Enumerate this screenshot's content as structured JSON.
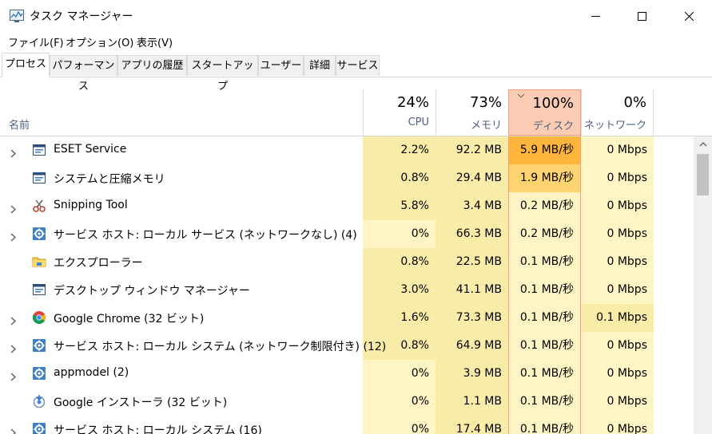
{
  "window": {
    "title": "タスク マネージャー",
    "icon": "task-manager-icon"
  },
  "menu": {
    "file": "ファイル(F)",
    "options": "オプション(O)",
    "view": "表示(V)"
  },
  "tabs": [
    {
      "label": "プロセス",
      "active": true
    },
    {
      "label": "パフォーマンス",
      "active": false
    },
    {
      "label": "アプリの履歴",
      "active": false
    },
    {
      "label": "スタートアップ",
      "active": false
    },
    {
      "label": "ユーザー",
      "active": false
    },
    {
      "label": "詳細",
      "active": false
    },
    {
      "label": "サービス",
      "active": false
    }
  ],
  "columns": {
    "name": "名前",
    "cpu": {
      "percent": "24%",
      "label": "CPU"
    },
    "memory": {
      "percent": "73%",
      "label": "メモリ"
    },
    "disk": {
      "percent": "100%",
      "label": "ディスク",
      "sorted": true
    },
    "network": {
      "percent": "0%",
      "label": "ネットワーク"
    }
  },
  "colors": {
    "cpu_light": "#fff4c4",
    "cpu_medium": "#f9eca8",
    "disk_light": "#fff4c4",
    "disk_medium": "#ffd36f",
    "disk_heavy": "#ffb53c",
    "sorted_header": "#fbcbb4",
    "header_label": "#4d6082"
  },
  "processes": [
    {
      "name": "ESET Service",
      "icon": "service-window-icon",
      "expandable": true,
      "cpu": "2.2%",
      "memory": "92.2 MB",
      "disk": "5.9 MB/秒",
      "network": "0 Mbps",
      "cpu_level": "medium",
      "mem_level": "medium",
      "disk_level": "heavy",
      "net_level": "light"
    },
    {
      "name": "システムと圧縮メモリ",
      "icon": "service-window-icon",
      "expandable": false,
      "cpu": "0.8%",
      "memory": "29.4 MB",
      "disk": "1.9 MB/秒",
      "network": "0 Mbps",
      "cpu_level": "medium",
      "mem_level": "medium",
      "disk_level": "medium",
      "net_level": "light"
    },
    {
      "name": "Snipping Tool",
      "icon": "scissors-icon",
      "expandable": true,
      "cpu": "5.8%",
      "memory": "3.4 MB",
      "disk": "0.2 MB/秒",
      "network": "0 Mbps",
      "cpu_level": "medium",
      "mem_level": "medium",
      "disk_level": "light",
      "net_level": "light"
    },
    {
      "name": "サービス ホスト: ローカル サービス (ネットワークなし) (4)",
      "icon": "gear-icon",
      "expandable": true,
      "cpu": "0%",
      "memory": "66.3 MB",
      "disk": "0.2 MB/秒",
      "network": "0 Mbps",
      "cpu_level": "light",
      "mem_level": "medium",
      "disk_level": "light",
      "net_level": "light"
    },
    {
      "name": "エクスプローラー",
      "icon": "folder-icon",
      "expandable": false,
      "cpu": "0.8%",
      "memory": "22.5 MB",
      "disk": "0.1 MB/秒",
      "network": "0 Mbps",
      "cpu_level": "medium",
      "mem_level": "medium",
      "disk_level": "light",
      "net_level": "light"
    },
    {
      "name": "デスクトップ ウィンドウ マネージャー",
      "icon": "service-window-icon",
      "expandable": false,
      "cpu": "3.0%",
      "memory": "41.1 MB",
      "disk": "0.1 MB/秒",
      "network": "0 Mbps",
      "cpu_level": "medium",
      "mem_level": "medium",
      "disk_level": "light",
      "net_level": "light"
    },
    {
      "name": "Google Chrome (32 ビット)",
      "icon": "chrome-icon",
      "expandable": true,
      "cpu": "1.6%",
      "memory": "73.3 MB",
      "disk": "0.1 MB/秒",
      "network": "0.1 Mbps",
      "cpu_level": "medium",
      "mem_level": "medium",
      "disk_level": "light",
      "net_level": "medium"
    },
    {
      "name": "サービス ホスト: ローカル システム (ネットワーク制限付き) (12)",
      "icon": "gear-icon",
      "expandable": true,
      "cpu": "0.8%",
      "memory": "64.9 MB",
      "disk": "0.1 MB/秒",
      "network": "0 Mbps",
      "cpu_level": "medium",
      "mem_level": "medium",
      "disk_level": "light",
      "net_level": "light"
    },
    {
      "name": "appmodel (2)",
      "icon": "gear-icon",
      "expandable": true,
      "cpu": "0%",
      "memory": "3.9 MB",
      "disk": "0.1 MB/秒",
      "network": "0 Mbps",
      "cpu_level": "light",
      "mem_level": "medium",
      "disk_level": "light",
      "net_level": "light"
    },
    {
      "name": "Google インストーラ (32 ビット)",
      "icon": "installer-icon",
      "expandable": false,
      "cpu": "0%",
      "memory": "1.1 MB",
      "disk": "0.1 MB/秒",
      "network": "0 Mbps",
      "cpu_level": "light",
      "mem_level": "medium",
      "disk_level": "light",
      "net_level": "light"
    },
    {
      "name": "サービス ホスト: ローカル システム (16)",
      "icon": "gear-icon",
      "expandable": true,
      "cpu": "0%",
      "memory": "17.4 MB",
      "disk": "0.1 MB/秒",
      "network": "0 Mbps",
      "cpu_level": "light",
      "mem_level": "medium",
      "disk_level": "light",
      "net_level": "light"
    }
  ]
}
